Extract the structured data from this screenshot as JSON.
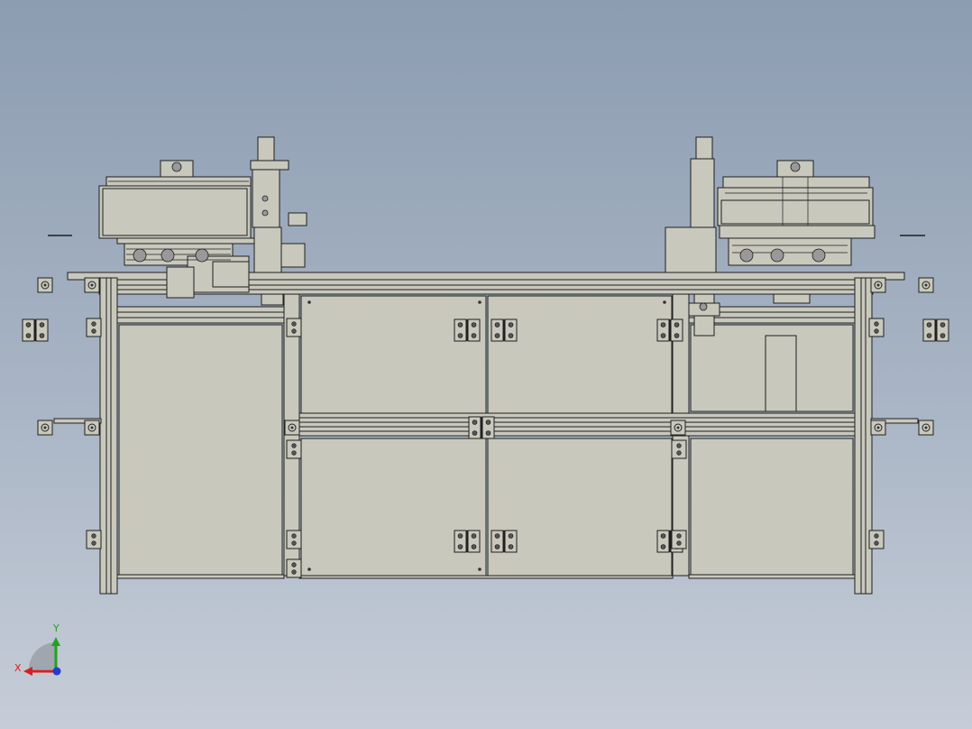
{
  "view": {
    "type": "cad-drawing-front-view",
    "background_top": "#8c9cb1",
    "background_bottom": "#c6cdd8",
    "part_fill": "#c8c8bd",
    "part_stroke": "#202020"
  },
  "triad": {
    "x_label": "X",
    "y_label": "Y",
    "x_color": "#d42020",
    "y_color": "#1fa31f",
    "z_color": "#1e3fd0"
  }
}
